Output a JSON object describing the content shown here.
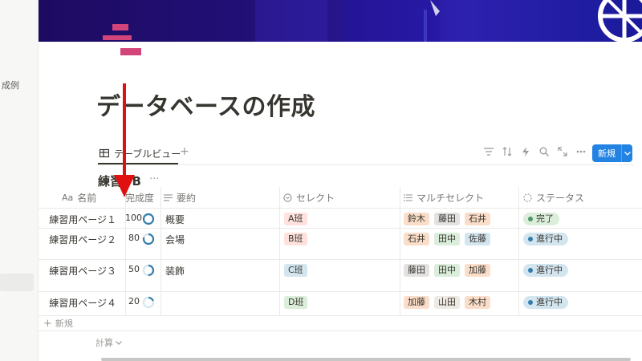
{
  "sidebar": {
    "partial_text": "成例"
  },
  "page": {
    "title": "データベースの作成"
  },
  "view": {
    "tab_label": "テーブルビュー",
    "add_view": "+"
  },
  "toolbar": {
    "icons": [
      "filter-icon",
      "sort-icon",
      "lightning-icon",
      "search-icon",
      "expand-icon",
      "more-icon"
    ],
    "new_button_label": "新規"
  },
  "database": {
    "title": "練習DB",
    "more": "···",
    "columns": [
      {
        "icon": "Aa",
        "label": "名前"
      },
      {
        "icon": "progress-icon",
        "label": "完成度"
      },
      {
        "icon": "text-icon",
        "label": "要約"
      },
      {
        "icon": "select-icon",
        "label": "セレクト"
      },
      {
        "icon": "list-icon",
        "label": "マルチセレクト"
      },
      {
        "icon": "status-icon",
        "label": "ステータス"
      }
    ],
    "rows": [
      {
        "name": "練習用ページ１",
        "progress": "100",
        "progress_fraction": 1.0,
        "summary": "概要",
        "select": "A班",
        "multi": [
          "鈴木",
          "藤田",
          "石井"
        ],
        "status": "完了"
      },
      {
        "name": "練習用ページ２",
        "progress": "80",
        "progress_fraction": 0.8,
        "summary": "会場",
        "select": "B班",
        "multi": [
          "石井",
          "田中",
          "佐藤"
        ],
        "status": "進行中"
      },
      {
        "name": "練習用ページ３",
        "progress": "50",
        "progress_fraction": 0.5,
        "summary": "装飾",
        "select": "C班",
        "multi": [
          "藤田",
          "田中",
          "加藤"
        ],
        "status": "進行中"
      },
      {
        "name": "練習用ページ４",
        "progress": "20",
        "progress_fraction": 0.2,
        "summary": "",
        "select": "D班",
        "multi": [
          "加藤",
          "山田",
          "木村"
        ],
        "status": "進行中"
      }
    ],
    "new_row_label": "新規",
    "calc_label": "計算"
  },
  "colors": {
    "accent": "#2383e2",
    "select_A": "#fbe4e4",
    "select_B": "#fbe4e4",
    "select_C": "#d3e5ef",
    "select_D": "#dbeddb",
    "status_done_bg": "#dbeddb",
    "status_done_dot": "#4f9768",
    "status_progress_bg": "#d3e5ef",
    "status_progress_dot": "#337ea9",
    "annotation": "#e01010"
  },
  "tag_colors": {
    "鈴木": "#fadec9",
    "藤田": "#e3e2e0",
    "石井": "#fadec9",
    "田中": "#dbeddb",
    "佐藤": "#d3e5ef",
    "加藤": "#fadec9",
    "山田": "#eeeae3",
    "木村": "#fadec9"
  },
  "select_colors": {
    "A班": "#ffe2dd",
    "B班": "#ffe2dd",
    "C班": "#d3e5ef",
    "D班": "#dbeddb"
  }
}
